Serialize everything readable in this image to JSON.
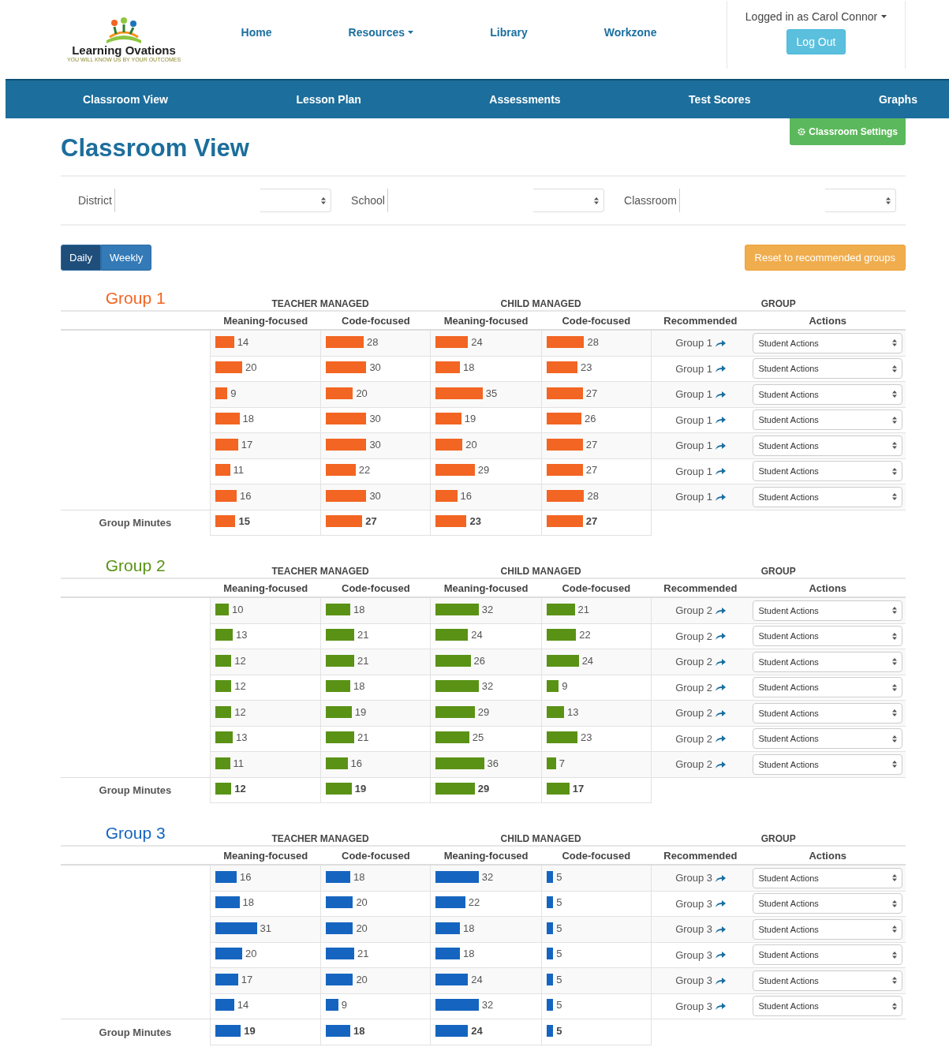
{
  "logo": {
    "name": "Learning Ovations",
    "tagline": "YOU WILL KNOW US BY YOUR OUTCOMES"
  },
  "top_nav": [
    {
      "label": "Home",
      "dropdown": false
    },
    {
      "label": "Resources",
      "dropdown": true
    },
    {
      "label": "Library",
      "dropdown": false
    },
    {
      "label": "Workzone",
      "dropdown": false
    }
  ],
  "user": {
    "label": "Logged in as Carol Connor",
    "logout": "Log Out"
  },
  "main_nav": [
    "Classroom View",
    "Lesson Plan",
    "Assessments",
    "Test Scores",
    "Graphs"
  ],
  "settings_button": "Classroom Settings",
  "page_title": "Classroom View",
  "filters": [
    {
      "label": "District"
    },
    {
      "label": "School"
    },
    {
      "label": "Classroom"
    }
  ],
  "view_toggle": [
    {
      "label": "Daily",
      "selected": true
    },
    {
      "label": "Weekly",
      "selected": false
    }
  ],
  "reset_button": "Reset to recommended groups",
  "groups": [
    {
      "title": "Group 1",
      "color": "#f26522",
      "headers": [
        "TEACHER MANAGED",
        "CHILD MANAGED",
        "GROUP"
      ],
      "columns": [
        "Meaning-focused",
        "Code-focused",
        "Meaning-focused",
        "Code-focused",
        "Recommended",
        "Actions"
      ],
      "rows": [
        {
          "values": [
            "14",
            "28",
            "24",
            "28"
          ],
          "recommended": "Group 1",
          "action": "Student Actions"
        },
        {
          "values": [
            "20",
            "30",
            "18",
            "23"
          ],
          "recommended": "Group 1",
          "action": "Student Actions"
        },
        {
          "values": [
            "9",
            "20",
            "35",
            "27"
          ],
          "recommended": "Group 1",
          "action": "Student Actions"
        },
        {
          "values": [
            "18",
            "30",
            "19",
            "26"
          ],
          "recommended": "Group 1",
          "action": "Student Actions"
        },
        {
          "values": [
            "17",
            "30",
            "20",
            "27"
          ],
          "recommended": "Group 1",
          "action": "Student Actions"
        },
        {
          "values": [
            "11",
            "22",
            "29",
            "27"
          ],
          "recommended": "Group 1",
          "action": "Student Actions"
        },
        {
          "values": [
            "16",
            "30",
            "16",
            "28"
          ],
          "recommended": "Group 1",
          "action": "Student Actions"
        }
      ],
      "minutes": {
        "label": "Group Minutes",
        "values": [
          "15",
          "27",
          "23",
          "27"
        ]
      }
    },
    {
      "title": "Group 2",
      "color": "#5a9216",
      "headers": [
        "TEACHER MANAGED",
        "CHILD MANAGED",
        "GROUP"
      ],
      "columns": [
        "Meaning-focused",
        "Code-focused",
        "Meaning-focused",
        "Code-focused",
        "Recommended",
        "Actions"
      ],
      "rows": [
        {
          "values": [
            "10",
            "18",
            "32",
            "21"
          ],
          "recommended": "Group 2",
          "action": "Student Actions"
        },
        {
          "values": [
            "13",
            "21",
            "24",
            "22"
          ],
          "recommended": "Group 2",
          "action": "Student Actions"
        },
        {
          "values": [
            "12",
            "21",
            "26",
            "24"
          ],
          "recommended": "Group 2",
          "action": "Student Actions"
        },
        {
          "values": [
            "12",
            "18",
            "32",
            "9"
          ],
          "recommended": "Group 2",
          "action": "Student Actions"
        },
        {
          "values": [
            "12",
            "19",
            "29",
            "13"
          ],
          "recommended": "Group 2",
          "action": "Student Actions"
        },
        {
          "values": [
            "13",
            "21",
            "25",
            "23"
          ],
          "recommended": "Group 2",
          "action": "Student Actions"
        },
        {
          "values": [
            "11",
            "16",
            "36",
            "7"
          ],
          "recommended": "Group 2",
          "action": "Student Actions"
        }
      ],
      "minutes": {
        "label": "Group Minutes",
        "values": [
          "12",
          "19",
          "29",
          "17"
        ]
      }
    },
    {
      "title": "Group 3",
      "color": "#1565c0",
      "headers": [
        "TEACHER MANAGED",
        "CHILD MANAGED",
        "GROUP"
      ],
      "columns": [
        "Meaning-focused",
        "Code-focused",
        "Meaning-focused",
        "Code-focused",
        "Recommended",
        "Actions"
      ],
      "rows": [
        {
          "values": [
            "16",
            "18",
            "32",
            "5"
          ],
          "recommended": "Group 3",
          "action": "Student Actions"
        },
        {
          "values": [
            "18",
            "20",
            "22",
            "5"
          ],
          "recommended": "Group 3",
          "action": "Student Actions"
        },
        {
          "values": [
            "31",
            "20",
            "18",
            "5"
          ],
          "recommended": "Group 3",
          "action": "Student Actions"
        },
        {
          "values": [
            "20",
            "21",
            "18",
            "5"
          ],
          "recommended": "Group 3",
          "action": "Student Actions"
        },
        {
          "values": [
            "17",
            "20",
            "24",
            "5"
          ],
          "recommended": "Group 3",
          "action": "Student Actions"
        },
        {
          "values": [
            "14",
            "9",
            "32",
            "5"
          ],
          "recommended": "Group 3",
          "action": "Student Actions"
        }
      ],
      "minutes": {
        "label": "Group Minutes",
        "values": [
          "19",
          "18",
          "24",
          "5"
        ]
      }
    }
  ]
}
